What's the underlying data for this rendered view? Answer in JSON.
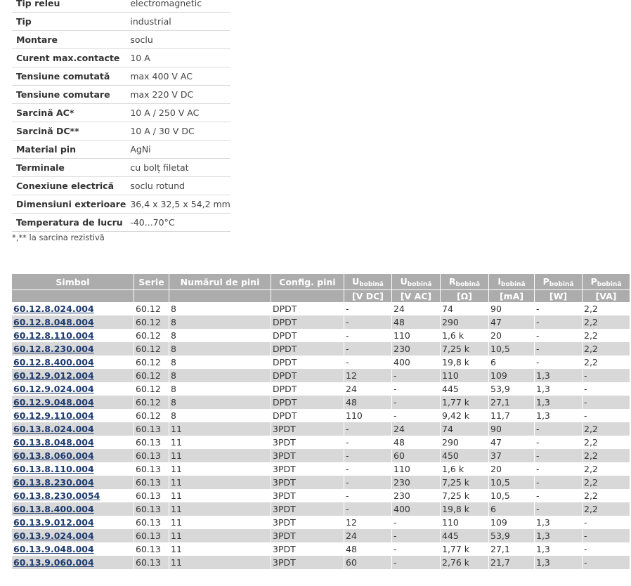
{
  "specs": [
    {
      "label": "Tip releu",
      "value": "electromagnetic"
    },
    {
      "label": "Tip",
      "value": "industrial"
    },
    {
      "label": "Montare",
      "value": "soclu"
    },
    {
      "label": "Curent max.contacte",
      "value": "10 A"
    },
    {
      "label": "Tensiune comutată",
      "value": "max 400 V AC"
    },
    {
      "label": "Tensiune comutare",
      "value": "max 220 V DC"
    },
    {
      "label": "Sarcină AC*",
      "value": "10 A / 250 V AC"
    },
    {
      "label": "Sarcină DC**",
      "value": "10 A / 30 V DC"
    },
    {
      "label": "Material pin",
      "value": "AgNi"
    },
    {
      "label": "Terminale",
      "value": "cu bolț filetat"
    },
    {
      "label": "Conexiune electrică",
      "value": "soclu rotund"
    },
    {
      "label": "Dimensiuni exterioare",
      "value": "36,4 x 32,5 x 54,2 mm"
    },
    {
      "label": "Temperatura de lucru",
      "value": "-40...70°C"
    }
  ],
  "note": "*,** la sarcina rezistivă",
  "table": {
    "headers": [
      {
        "main": "Simbol",
        "sub": "",
        "unit": ""
      },
      {
        "main": "Serie",
        "sub": "",
        "unit": ""
      },
      {
        "main": "Numărul de pini",
        "sub": "",
        "unit": ""
      },
      {
        "main": "Config. pini",
        "sub": "",
        "unit": ""
      },
      {
        "main": "U",
        "sub": "bobină",
        "unit": "[V DC]"
      },
      {
        "main": "U",
        "sub": "bobină",
        "unit": "[V AC]"
      },
      {
        "main": "R",
        "sub": "bobină",
        "unit": "[Ω]"
      },
      {
        "main": "I",
        "sub": "bobină",
        "unit": "[mA]"
      },
      {
        "main": "P",
        "sub": "bobină",
        "unit": "[W]"
      },
      {
        "main": "P",
        "sub": "bobină",
        "unit": "[VA]"
      }
    ],
    "rows": [
      [
        "60.12.8.024.004",
        "60.12",
        "8",
        "DPDT",
        "-",
        "24",
        "74",
        "90",
        "-",
        "2,2"
      ],
      [
        "60.12.8.048.004",
        "60.12",
        "8",
        "DPDT",
        "-",
        "48",
        "290",
        "47",
        "-",
        "2,2"
      ],
      [
        "60.12.8.110.004",
        "60.12",
        "8",
        "DPDT",
        "-",
        "110",
        "1,6 k",
        "20",
        "-",
        "2,2"
      ],
      [
        "60.12.8.230.004",
        "60.12",
        "8",
        "DPDT",
        "-",
        "230",
        "7,25 k",
        "10,5",
        "-",
        "2,2"
      ],
      [
        "60.12.8.400.004",
        "60.12",
        "8",
        "DPDT",
        "-",
        "400",
        "19,8 k",
        "6",
        "-",
        "2,2"
      ],
      [
        "60.12.9.012.004",
        "60.12",
        "8",
        "DPDT",
        "12",
        "-",
        "110",
        "109",
        "1,3",
        "-"
      ],
      [
        "60.12.9.024.004",
        "60.12",
        "8",
        "DPDT",
        "24",
        "-",
        "445",
        "53,9",
        "1,3",
        "-"
      ],
      [
        "60.12.9.048.004",
        "60.12",
        "8",
        "DPDT",
        "48",
        "-",
        "1,77 k",
        "27,1",
        "1,3",
        "-"
      ],
      [
        "60.12.9.110.004",
        "60.12",
        "8",
        "DPDT",
        "110",
        "-",
        "9,42 k",
        "11,7",
        "1,3",
        "-"
      ],
      [
        "60.13.8.024.004",
        "60.13",
        "11",
        "3PDT",
        "-",
        "24",
        "74",
        "90",
        "-",
        "2,2"
      ],
      [
        "60.13.8.048.004",
        "60.13",
        "11",
        "3PDT",
        "-",
        "48",
        "290",
        "47",
        "-",
        "2,2"
      ],
      [
        "60.13.8.060.004",
        "60.13",
        "11",
        "3PDT",
        "-",
        "60",
        "450",
        "37",
        "-",
        "2,2"
      ],
      [
        "60.13.8.110.004",
        "60.13",
        "11",
        "3PDT",
        "-",
        "110",
        "1,6 k",
        "20",
        "-",
        "2,2"
      ],
      [
        "60.13.8.230.004",
        "60.13",
        "11",
        "3PDT",
        "-",
        "230",
        "7,25 k",
        "10,5",
        "-",
        "2,2"
      ],
      [
        "60.13.8.230.0054",
        "60.13",
        "11",
        "3PDT",
        "-",
        "230",
        "7,25 k",
        "10,5",
        "-",
        "2,2"
      ],
      [
        "60.13.8.400.004",
        "60.13",
        "11",
        "3PDT",
        "-",
        "400",
        "19,8 k",
        "6",
        "-",
        "2,2"
      ],
      [
        "60.13.9.012.004",
        "60.13",
        "11",
        "3PDT",
        "12",
        "-",
        "110",
        "109",
        "1,3",
        "-"
      ],
      [
        "60.13.9.024.004",
        "60.13",
        "11",
        "3PDT",
        "24",
        "-",
        "445",
        "53,9",
        "1,3",
        "-"
      ],
      [
        "60.13.9.048.004",
        "60.13",
        "11",
        "3PDT",
        "48",
        "-",
        "1,77 k",
        "27,1",
        "1,3",
        "-"
      ],
      [
        "60.13.9.060.004",
        "60.13",
        "11",
        "3PDT",
        "60",
        "-",
        "2,76 k",
        "21,7",
        "1,3",
        "-"
      ]
    ]
  }
}
